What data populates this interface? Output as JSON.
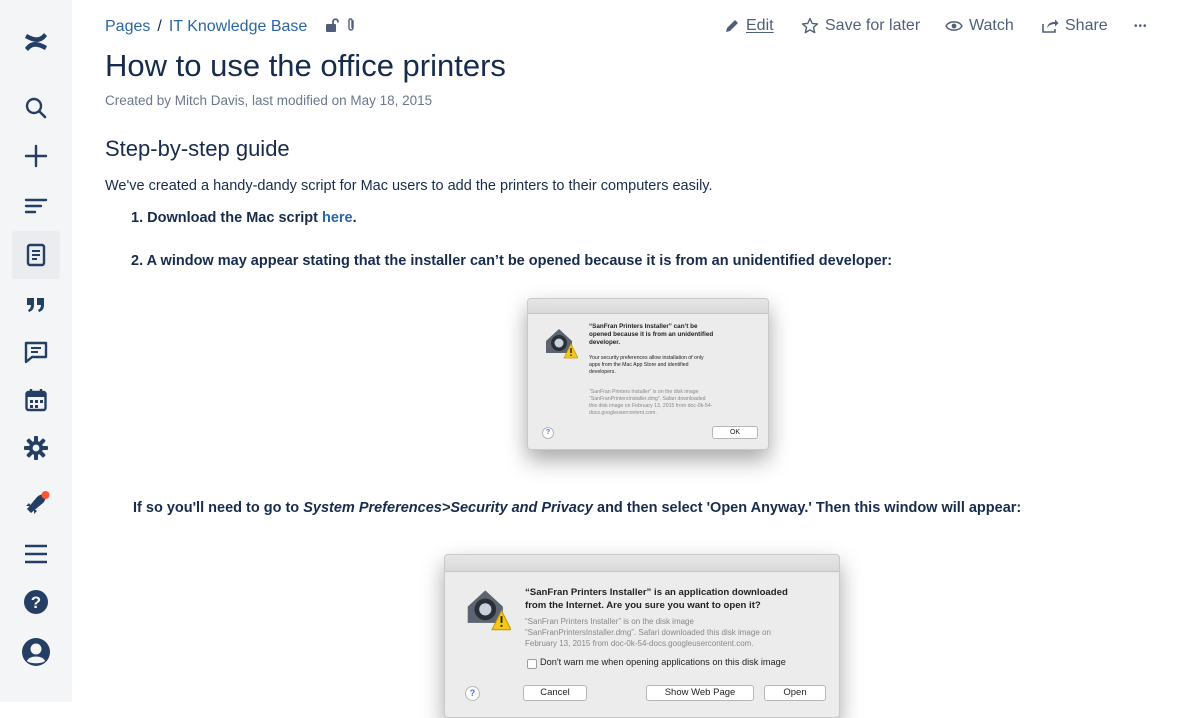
{
  "breadcrumb": {
    "items": [
      "Pages",
      "IT Knowledge Base"
    ],
    "separator": "/"
  },
  "actions": {
    "edit": "Edit",
    "save_for_later": "Save for later",
    "watch": "Watch",
    "share": "Share",
    "more": "•••"
  },
  "page": {
    "title": "How to use the office printers",
    "byline": "Created by Mitch Davis, last modified on May 18, 2015",
    "heading": "Step-by-step guide",
    "intro": "We've created a handy-dandy script for Mac users to add the printers to their computers easily.",
    "step1": {
      "number": "1.",
      "text": "Download the Mac script ",
      "link": "here",
      "end": "."
    },
    "step2": {
      "number": "2.",
      "text": "A window may appear stating that the installer can’t be opened because it is from an unidentified developer:"
    },
    "para3": {
      "a": "If so you'll need to go to ",
      "b": "System Preferences>Security and Privacy",
      "c": " and then select 'Open Anyway.' Then this window will appear:"
    }
  },
  "dialog1": {
    "title_line1": "“SanFran Printers Installer” can’t be",
    "title_line2": "opened because it is from an unidentified",
    "title_line3": "developer.",
    "body_line1": "Your security preferences allow installation of only",
    "body_line2": "apps from the Mac App Store and identified",
    "body_line3": "developers.",
    "info_line1": "“SanFran Printers Installer” is on the disk image",
    "info_line2": "“SanFranPrintersInstaller.dmg”. Safari downloaded",
    "info_line3": "this disk image on February 13, 2015 from doc-0k-54-",
    "info_line4": "docs.googleusercontent.com.",
    "help": "?",
    "ok": "OK"
  },
  "dialog2": {
    "title_line1": "“SanFran Printers Installer” is an application downloaded",
    "title_line2": "from the Internet. Are you sure you want to open it?",
    "info_line1": "“SanFran Printers Installer” is on the disk image",
    "info_line2": "“SanFranPrintersInstaller.dmg”. Safari downloaded this disk image on",
    "info_line3": "February 13, 2015 from doc-0k-54-docs.googleusercontent.com.",
    "checkbox_label": "Don't warn me when opening applications on this disk image",
    "help": "?",
    "cancel": "Cancel",
    "show_web_page": "Show Web Page",
    "open": "Open"
  },
  "sidebar": {
    "items": [
      {
        "icon": "confluence-logo-icon"
      },
      {
        "icon": "search-icon"
      },
      {
        "icon": "plus-icon"
      },
      {
        "icon": "recent-list-icon"
      },
      {
        "icon": "pages-icon"
      },
      {
        "icon": "quote-icon"
      },
      {
        "icon": "feedback-icon"
      },
      {
        "icon": "calendar-icon"
      },
      {
        "icon": "gear-icon"
      },
      {
        "icon": "notification-icon"
      },
      {
        "icon": "menu-icon"
      },
      {
        "icon": "help-icon"
      },
      {
        "icon": "avatar-icon"
      }
    ]
  },
  "colors": {
    "link": "#2b65a8",
    "sidebar_icon": "#243f63",
    "notification_dot": "#ff5630",
    "text": "#172b4d"
  }
}
